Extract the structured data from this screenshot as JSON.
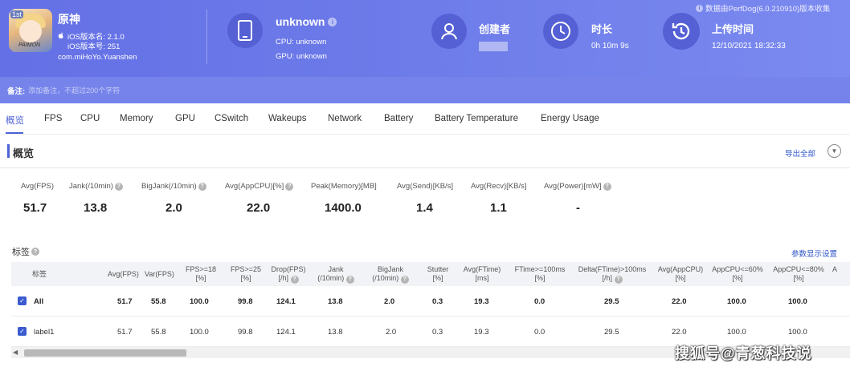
{
  "header": {
    "app_name": "原神",
    "ios_version_name": "iOS版本名: 2.1.0",
    "ios_version_code": "iOS版本号: 251",
    "package": "com.miHoYo.Yuanshen",
    "app_icon_badge": "1st",
    "app_icon_logo": "PAIMON",
    "device": {
      "title": "unknown",
      "cpu": "CPU: unknown",
      "gpu": "GPU: unknown"
    },
    "creator_label": "创建者",
    "duration_label": "时长",
    "duration_value": "0h 10m 9s",
    "upload_label": "上传时间",
    "upload_value": "12/10/2021 18:32:33",
    "source_note": "数据由PerfDog(6.0.210910)版本收集"
  },
  "remark": {
    "label": "备注:",
    "placeholder": "添加备注，不超过200个字符"
  },
  "tabs": [
    {
      "label": "概览",
      "active": true
    },
    {
      "label": "FPS"
    },
    {
      "label": "CPU"
    },
    {
      "label": "Memory"
    },
    {
      "label": "GPU"
    },
    {
      "label": "CSwitch"
    },
    {
      "label": "Wakeups"
    },
    {
      "label": "Network"
    },
    {
      "label": "Battery"
    },
    {
      "label": "Battery Temperature"
    },
    {
      "label": "Energy Usage"
    }
  ],
  "overview": {
    "title": "概览",
    "export_label": "导出全部",
    "metrics": [
      {
        "label": "Avg(FPS)",
        "value": "51.7",
        "help": false
      },
      {
        "label": "Jank(/10min)",
        "value": "13.8",
        "help": true
      },
      {
        "label": "BigJank(/10min)",
        "value": "2.0",
        "help": true
      },
      {
        "label": "Avg(AppCPU)[%]",
        "value": "22.0",
        "help": true
      },
      {
        "label": "Peak(Memory)[MB]",
        "value": "1400.0",
        "help": false
      },
      {
        "label": "Avg(Send)[KB/s]",
        "value": "1.4",
        "help": false
      },
      {
        "label": "Avg(Recv)[KB/s]",
        "value": "1.1",
        "help": false
      },
      {
        "label": "Avg(Power)[mW]",
        "value": "-",
        "help": true
      }
    ]
  },
  "tags": {
    "title": "标签",
    "param_settings_label": "参数显示设置",
    "columns": [
      {
        "l1": "标签",
        "l2": ""
      },
      {
        "l1": "Avg(FPS)",
        "l2": ""
      },
      {
        "l1": "Var(FPS)",
        "l2": ""
      },
      {
        "l1": "FPS>=18",
        "l2": "[%]"
      },
      {
        "l1": "FPS>=25",
        "l2": "[%]"
      },
      {
        "l1": "Drop(FPS)",
        "l2": "[/h]"
      },
      {
        "l1": "Jank",
        "l2": "(/10min)"
      },
      {
        "l1": "BigJank",
        "l2": "(/10min)"
      },
      {
        "l1": "Stutter",
        "l2": "[%]"
      },
      {
        "l1": "Avg(FTime)",
        "l2": "[ms]"
      },
      {
        "l1": "FTime>=100ms",
        "l2": "[%]"
      },
      {
        "l1": "Delta(FTime)>100ms",
        "l2": "[/h]"
      },
      {
        "l1": "Avg(AppCPU)",
        "l2": "[%]"
      },
      {
        "l1": "AppCPU<=60%",
        "l2": "[%]"
      },
      {
        "l1": "AppCPU<=80%",
        "l2": "[%]"
      },
      {
        "l1": "A",
        "l2": ""
      }
    ],
    "rows": [
      {
        "name": "All",
        "values": [
          "51.7",
          "55.8",
          "100.0",
          "99.8",
          "124.1",
          "13.8",
          "2.0",
          "0.3",
          "19.3",
          "0.0",
          "29.5",
          "22.0",
          "100.0",
          "100.0"
        ]
      },
      {
        "name": "label1",
        "values": [
          "51.7",
          "55.8",
          "100.0",
          "99.8",
          "124.1",
          "13.8",
          "2.0",
          "0.3",
          "19.3",
          "0.0",
          "29.5",
          "22.0",
          "100.0",
          "100.0"
        ]
      }
    ]
  },
  "watermark": "搜狐号@青葱科技说",
  "icons": {
    "apple": "apple-icon",
    "device": "phone-icon",
    "creator": "user-icon",
    "duration": "clock-icon",
    "upload": "history-icon"
  }
}
